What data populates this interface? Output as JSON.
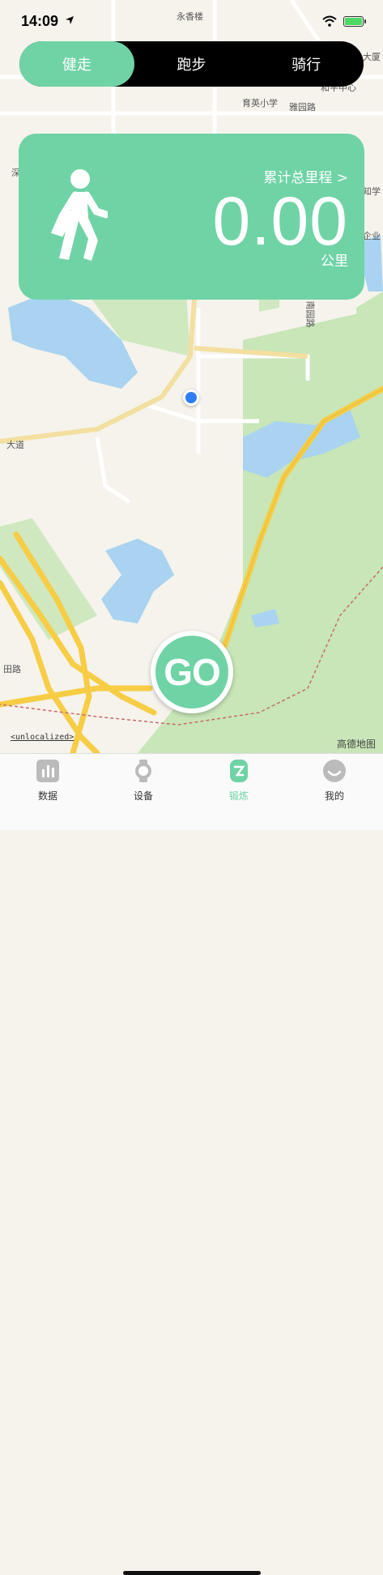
{
  "status_bar": {
    "time": "14:09"
  },
  "modes": [
    {
      "label": "健走",
      "active": true
    },
    {
      "label": "跑步",
      "active": false
    },
    {
      "label": "骑行",
      "active": false
    }
  ],
  "stats_card": {
    "total_label": "累计总里程 >",
    "distance": "0.00",
    "unit": "公里"
  },
  "map": {
    "labels": {
      "poi_1": "永香楼",
      "poi_2": "育英小学",
      "road_1": "雅园路",
      "road_2": "大道",
      "road_3": "田路",
      "road_4": "南园路",
      "edge_1": "大厦",
      "edge_2": "和平中心",
      "edge_3": "知学",
      "edge_4": "企业",
      "edge_5": "深"
    },
    "unlocalized": "<unlocalized>",
    "provider": "高德地图"
  },
  "go_button": {
    "label": "GO"
  },
  "tab_bar": [
    {
      "label": "数据",
      "icon": "chart-icon",
      "active": false
    },
    {
      "label": "设备",
      "icon": "watch-icon",
      "active": false
    },
    {
      "label": "锻炼",
      "icon": "exercise-icon",
      "active": true
    },
    {
      "label": "我的",
      "icon": "profile-icon",
      "active": false
    }
  ],
  "colors": {
    "accent": "#6fd3a6",
    "location": "#2f7cf6",
    "water": "#a9d3f0",
    "park": "#c8e6b8",
    "highway": "#f6cd45"
  }
}
